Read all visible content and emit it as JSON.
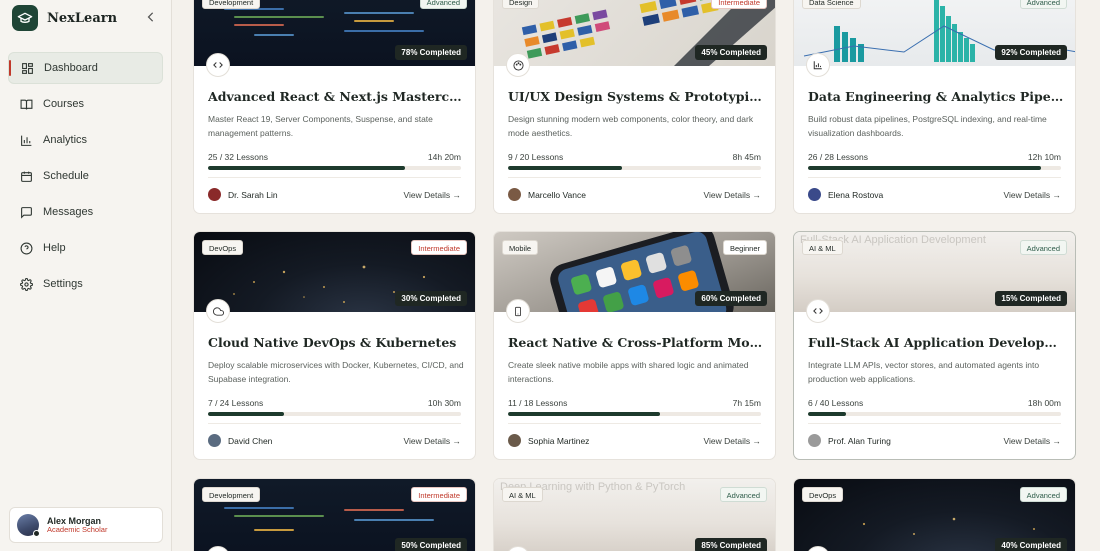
{
  "brand": {
    "name": "NexLearn"
  },
  "nav": [
    {
      "label": "Dashboard",
      "icon": "dashboard-icon",
      "active": true
    },
    {
      "label": "Courses",
      "icon": "book-icon",
      "active": false
    },
    {
      "label": "Analytics",
      "icon": "bar-chart-icon",
      "active": false
    },
    {
      "label": "Schedule",
      "icon": "calendar-icon",
      "active": false
    },
    {
      "label": "Messages",
      "icon": "message-icon",
      "active": false
    },
    {
      "label": "Help",
      "icon": "help-icon",
      "active": false
    },
    {
      "label": "Settings",
      "icon": "gear-icon",
      "active": false
    }
  ],
  "user": {
    "name": "Alex Morgan",
    "role": "Academic Scholar"
  },
  "courses": [
    {
      "category": "Development",
      "level": "Advanced",
      "completed_label": "78% Completed",
      "progress": 0.78,
      "title": "Advanced React & Next.js Masterclass",
      "description": "Master React 19, Server Components, Suspense, and state management patterns.",
      "lessons": "25 / 32 Lessons",
      "duration": "14h 20m",
      "instructor": "Dr. Sarah Lin",
      "details": "View Details →",
      "icon": "code-icon"
    },
    {
      "category": "Design",
      "level": "Intermediate",
      "completed_label": "45% Completed",
      "progress": 0.45,
      "title": "UI/UX Design Systems & Prototyping",
      "description": "Design stunning modern web components, color theory, and dark mode aesthetics.",
      "lessons": "9 / 20 Lessons",
      "duration": "8h 45m",
      "instructor": "Marcello Vance",
      "details": "View Details →",
      "icon": "palette-icon"
    },
    {
      "category": "Data Science",
      "level": "Advanced",
      "completed_label": "92% Completed",
      "progress": 0.92,
      "title": "Data Engineering & Analytics Pipelines",
      "description": "Build robust data pipelines, PostgreSQL indexing, and real-time visualization dashboards.",
      "lessons": "26 / 28 Lessons",
      "duration": "12h 10m",
      "instructor": "Elena Rostova",
      "details": "View Details →",
      "icon": "chart-icon"
    },
    {
      "category": "DevOps",
      "level": "Intermediate",
      "completed_label": "30% Completed",
      "progress": 0.3,
      "title": "Cloud Native DevOps & Kubernetes",
      "description": "Deploy scalable microservices with Docker, Kubernetes, CI/CD, and Supabase integration.",
      "lessons": "7 / 24 Lessons",
      "duration": "10h 30m",
      "instructor": "David Chen",
      "details": "View Details →",
      "icon": "cloud-icon"
    },
    {
      "category": "Mobile",
      "level": "Beginner",
      "completed_label": "60% Completed",
      "progress": 0.6,
      "title": "React Native & Cross-Platform Mobile",
      "description": "Create sleek native mobile apps with shared logic and animated interactions.",
      "lessons": "11 / 18 Lessons",
      "duration": "7h 15m",
      "instructor": "Sophia Martinez",
      "details": "View Details →",
      "icon": "smartphone-icon"
    },
    {
      "category": "AI & ML",
      "level": "Advanced",
      "completed_label": "15% Completed",
      "progress": 0.15,
      "title": "Full-Stack AI Application Development",
      "description": "Integrate LLM APIs, vector stores, and automated agents into production web applications.",
      "lessons": "6 / 40 Lessons",
      "duration": "18h 00m",
      "instructor": "Prof. Alan Turing",
      "details": "View Details →",
      "icon": "code-icon",
      "image_alt": "Full-Stack AI Application Development"
    },
    {
      "category": "Development",
      "level": "Intermediate",
      "completed_label": "50% Completed",
      "progress": 0.5,
      "icon": "code-icon"
    },
    {
      "category": "AI & ML",
      "level": "Advanced",
      "completed_label": "85% Completed",
      "progress": 0.85,
      "icon": "code-icon",
      "image_alt": "Deep Learning with Python & PyTorch"
    },
    {
      "category": "DevOps",
      "level": "Advanced",
      "completed_label": "40% Completed",
      "progress": 0.4,
      "icon": "cloud-icon"
    }
  ]
}
